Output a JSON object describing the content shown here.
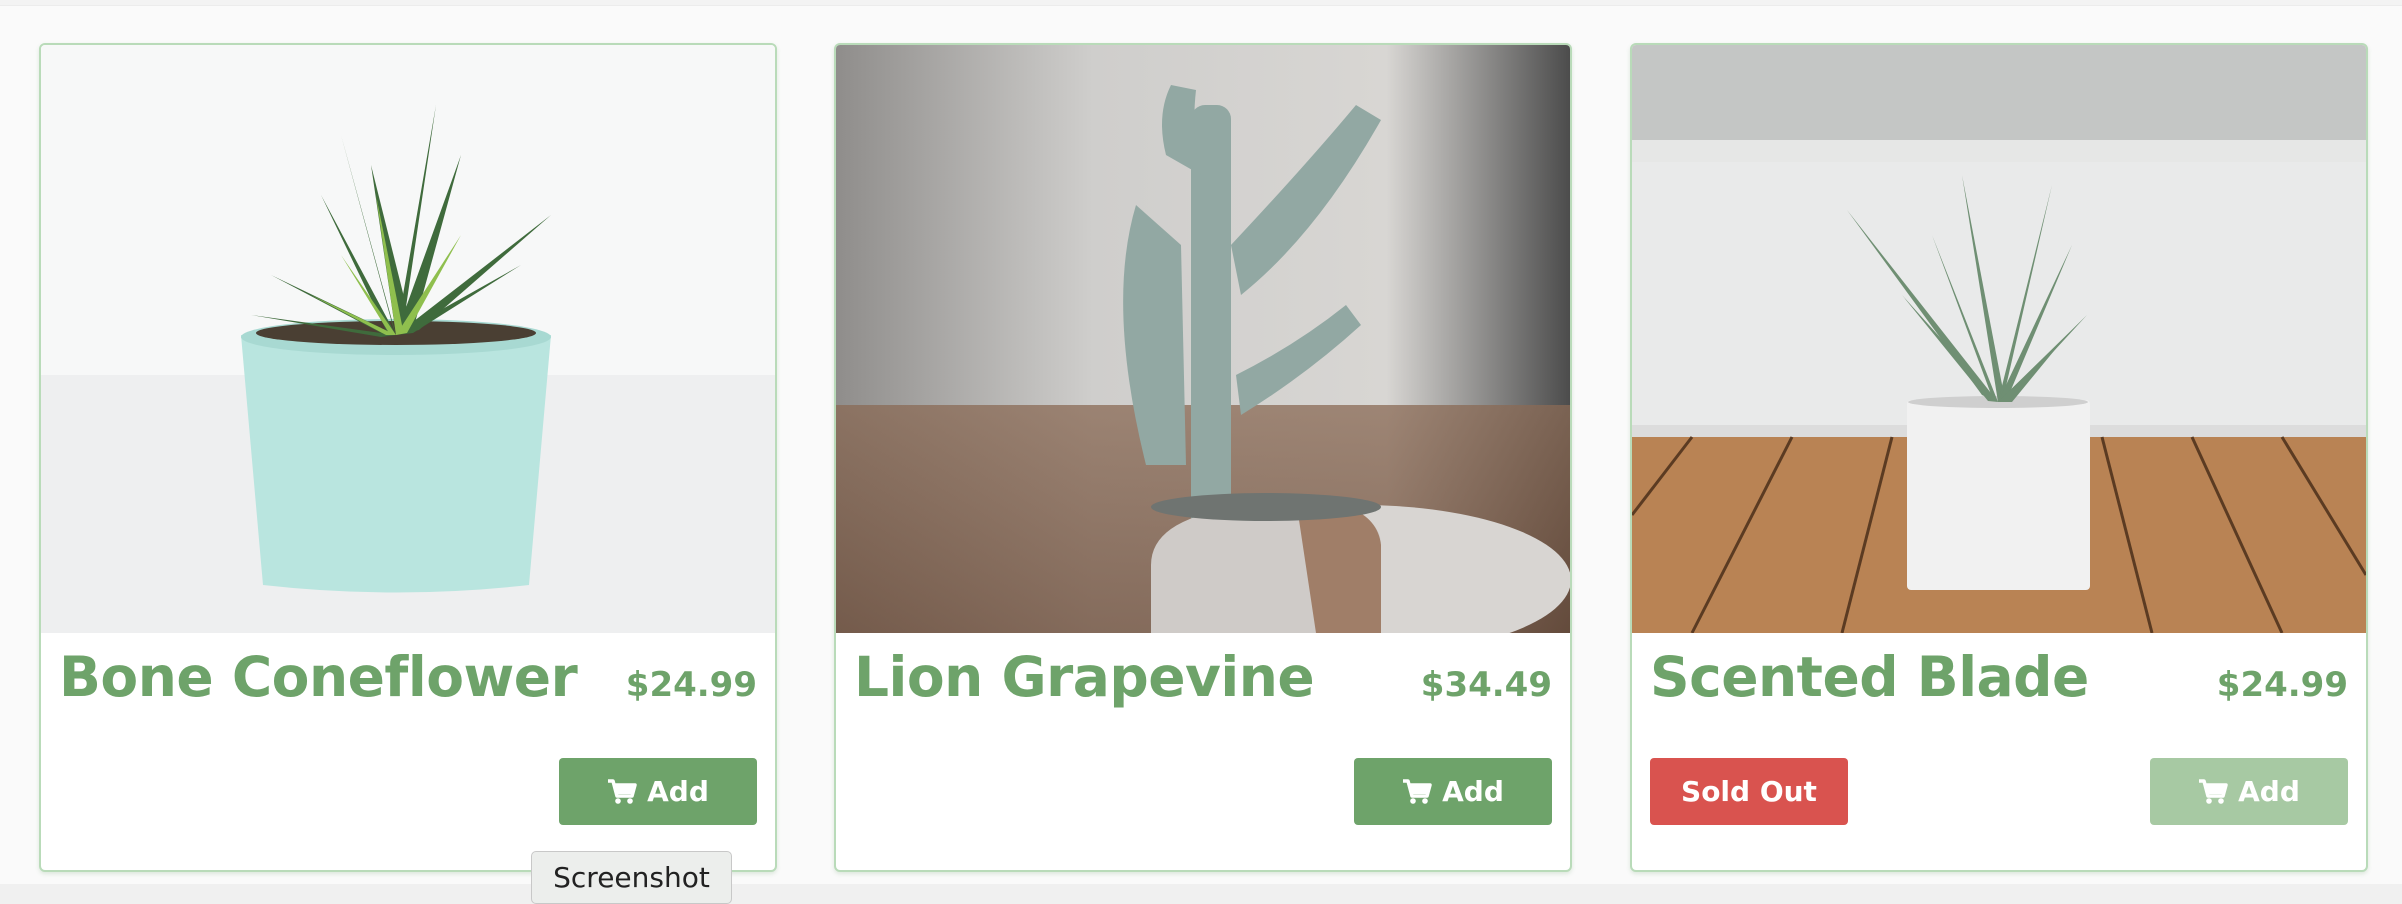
{
  "products": [
    {
      "name": "Bone Coneflower",
      "price": "$24.99",
      "add_label": "Add",
      "sold_out": false,
      "add_disabled": false
    },
    {
      "name": "Lion Grapevine",
      "price": "$34.49",
      "add_label": "Add",
      "sold_out": false,
      "add_disabled": false
    },
    {
      "name": "Scented Blade",
      "price": "$24.99",
      "add_label": "Add",
      "sold_out": true,
      "sold_out_label": "Sold Out",
      "add_disabled": true
    }
  ],
  "tooltip": {
    "text": "Screenshot"
  },
  "colors": {
    "accent": "#6ea36a",
    "accent_disabled": "#a7c9a3",
    "danger": "#d9534f",
    "card_border": "#b9dbb9"
  },
  "icons": {
    "cart": "shopping-cart-icon"
  }
}
